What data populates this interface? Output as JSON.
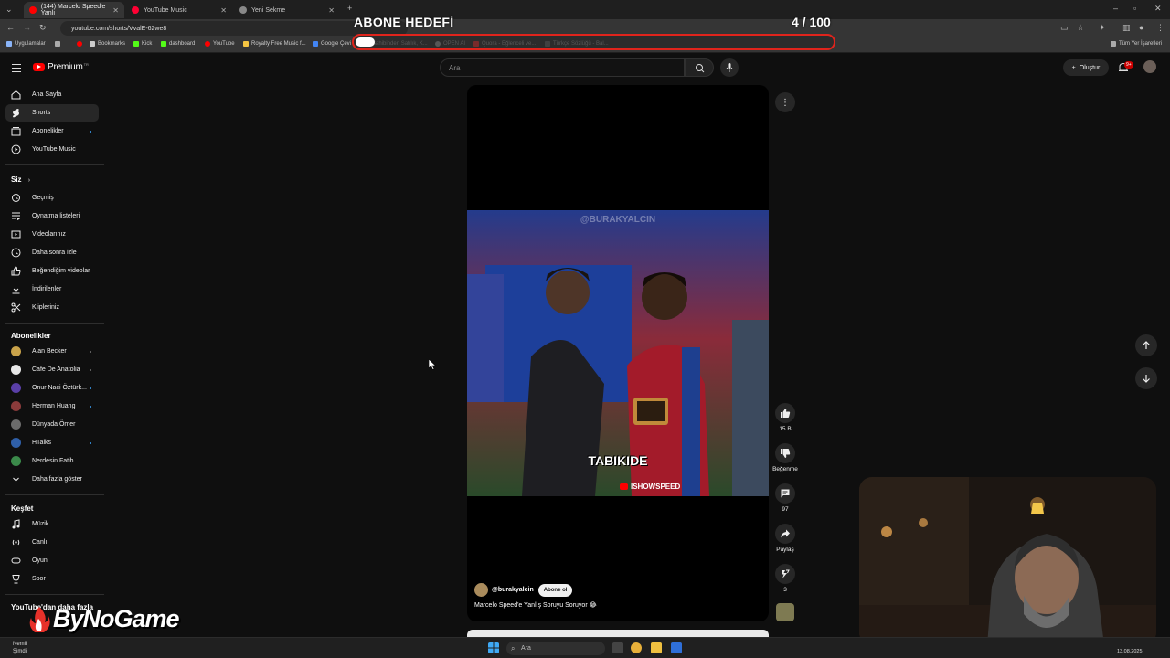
{
  "browser": {
    "tabs": [
      {
        "label": "(144) Marcelo Speed'e Yanlı",
        "active": true
      },
      {
        "label": "YouTube Music",
        "active": false
      },
      {
        "label": "Yeni Sekme",
        "active": false
      }
    ],
    "new_tab_symbol": "+",
    "url": "youtube.com/shorts/VvalE-62we8",
    "bookmarks": [
      "Uygulamalar",
      "Bookmarks",
      "Kick",
      "dashboard",
      "YouTube",
      "Royalty Free Music f...",
      "Google Çevi",
      "Sahibinden Satılık, K...",
      "OPEN AI",
      "Quora - Eğlenceli ve...",
      "Türkçe Sözlüğü - Bal..."
    ],
    "all_bookmarks": "Tüm Yer İşaretleri"
  },
  "goal_overlay": {
    "title": "ABONE HEDEFİ",
    "count_text": "4  / 100",
    "current": 4,
    "target": 100
  },
  "header": {
    "logo_text": "Premium",
    "logo_tr": "TR",
    "search_placeholder": "Ara",
    "create_label": "Oluştur",
    "notif_badge": "9+"
  },
  "sidebar": {
    "main": [
      {
        "label": "Ana Sayfa",
        "icon": "home-icon"
      },
      {
        "label": "Shorts",
        "icon": "shorts-icon",
        "active": true
      },
      {
        "label": "Abonelikler",
        "icon": "subscriptions-icon"
      },
      {
        "label": "YouTube Music",
        "icon": "youtube-music-icon"
      }
    ],
    "you_heading": "Siz",
    "you": [
      {
        "label": "Geçmiş",
        "icon": "history-icon"
      },
      {
        "label": "Oynatma listeleri",
        "icon": "playlists-icon"
      },
      {
        "label": "Videolarınız",
        "icon": "your-videos-icon"
      },
      {
        "label": "Daha sonra izle",
        "icon": "watch-later-icon"
      },
      {
        "label": "Beğendiğim videolar",
        "icon": "liked-icon"
      },
      {
        "label": "İndirilenler",
        "icon": "download-icon"
      },
      {
        "label": "Klipleriniz",
        "icon": "clips-icon"
      }
    ],
    "subs_heading": "Abonelikler",
    "subscriptions": [
      {
        "label": "Alan Becker",
        "color": "#c9a34a"
      },
      {
        "label": "Cafe De Anatolia",
        "color": "#e8e8e8"
      },
      {
        "label": "Onur Naci Öztürk...",
        "color": "#5a3fa8"
      },
      {
        "label": "Herman Huang",
        "color": "#8a3b3b"
      },
      {
        "label": "Dünyada Ömer",
        "color": "#6b6b6b"
      },
      {
        "label": "HTalks",
        "color": "#2f5fa8"
      },
      {
        "label": "Nerdesin Fatih",
        "color": "#3b8a4a"
      }
    ],
    "show_more": "Daha fazla göster",
    "explore_heading": "Keşfet",
    "explore": [
      {
        "label": "Müzik",
        "icon": "music-icon"
      },
      {
        "label": "Canlı",
        "icon": "live-icon"
      },
      {
        "label": "Oyun",
        "icon": "gaming-icon"
      },
      {
        "label": "Spor",
        "icon": "sports-icon"
      }
    ],
    "more_heading": "YouTube'dan daha fazla"
  },
  "short": {
    "watermark": "@BURAKYALCIN",
    "caption": "TABIKIDE",
    "ish_label": "ISHOWSPEED",
    "channel": "@burakyalcin",
    "subscribe_label": "Abone ol",
    "title": "Marcelo Speed'e Yanlış Soruyu Soruyor 😂"
  },
  "actions": {
    "likes": "15 B",
    "dislike_label": "Beğenme",
    "comments": "97",
    "share_label": "Paylaş",
    "remix_count": "3"
  },
  "overlay_brand": "ByNoGame",
  "taskbar": {
    "weather_title": "Nemli",
    "weather_sub": "Şimdi",
    "search_placeholder": "Ara",
    "date": "13.08.2025"
  },
  "colors": {
    "youtube_red": "#ff0000",
    "goal_border": "#e0241c",
    "background": "#0f0f0f"
  }
}
